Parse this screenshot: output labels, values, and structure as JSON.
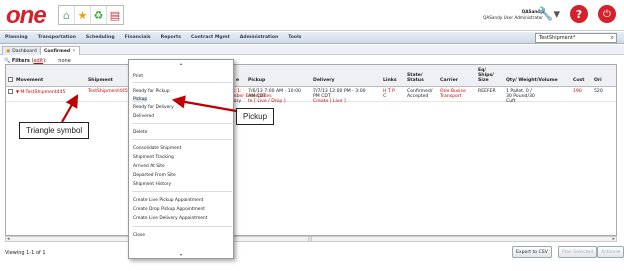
{
  "app": {
    "logo_text": "one",
    "user_name": "QASandy",
    "user_role": "QASandy User Administrator",
    "brand_color": "#d6202a"
  },
  "toolbar_icons": [
    "home-icon",
    "favorites-star-icon",
    "recycle-icon",
    "reports-icon"
  ],
  "nav": {
    "items": [
      "Planning",
      "Transportation",
      "Scheduling",
      "Financials",
      "Reports",
      "Contract Mgmt",
      "Administration",
      "Tools"
    ],
    "search_value": "TestShipment*"
  },
  "tabs": [
    {
      "label": "Dashboard"
    },
    {
      "label": "Confirmed"
    }
  ],
  "filters": {
    "label": "Filters",
    "edit_label": "edit",
    "suffix": "):",
    "value": "none"
  },
  "grid": {
    "columns": [
      "Movement",
      "Shipment",
      "e",
      "Pickup",
      "Delivery",
      "Links",
      "State/ Status",
      "Carrier",
      "Eq/ Ships/ Size",
      "Qty/ Weight/Volume",
      "Cost",
      "Ori"
    ],
    "row": {
      "movement": "M-TestShipment445",
      "shipment": "TestShipment445",
      "e_line1": "ic 1:",
      "e_line2": "mber Enterprises",
      "e_line3": "tory",
      "pickup_line1": "7/6/13 7:00 AM - 10:00",
      "pickup_line2": "AM CDT",
      "pickup_line3": "te [ Live / Drop ]",
      "delivery_line1": "7/7/13 12:00 PM - 3:00",
      "delivery_line2": "PM CDT",
      "delivery_line3": "Create [ Live ]",
      "links_line1": "H T P",
      "links_line2": "C",
      "state_line1": "Confirmed/",
      "state_line2": "Accepted",
      "carrier_line1": "One Busise",
      "carrier_line2": "Transport",
      "eq": "REEFER",
      "qty_line1": "1 Pallet. 0 /",
      "qty_line2": "30 Pound/30",
      "qty_line3": "Cuft",
      "cost": "190",
      "ori": "520"
    }
  },
  "context_menu": {
    "items": [
      "Print",
      "Ready for Pickup",
      "Pickup",
      "Ready for Delivery",
      "Delivered",
      "Delete",
      "Consolidate Shipment",
      "Shipment Tracking",
      "Arrived At Site",
      "Departed From Site",
      "Shipment History",
      "Create Live Pickup Appointment",
      "Create Drop Pickup Appointment",
      "Create Live Delivery Appointment",
      "Close"
    ],
    "highlighted": "Pickup"
  },
  "callouts": {
    "triangle": "Triangle symbol",
    "pickup": "Pickup",
    "color": "#c00000"
  },
  "footer": {
    "viewing": "Viewing 1-1 of 1",
    "export_csv": "Export to CSV",
    "plan_selected": "Plan Selected",
    "actions": "Actions"
  }
}
